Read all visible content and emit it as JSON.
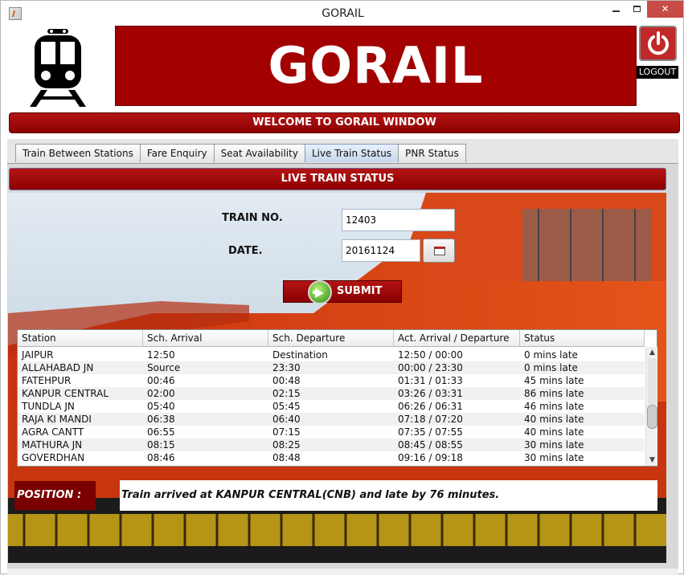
{
  "window": {
    "title": "GORAIL",
    "close_glyph": "✕",
    "icons": [
      "app-icon",
      "minimize-icon",
      "maximize-icon",
      "close-icon"
    ]
  },
  "header": {
    "banner_title": "GORAIL",
    "logout_label": "LOGOUT",
    "logo_icon": "train-icon",
    "logout_icon": "power-icon",
    "welcome": "WELCOME TO GORAIL WINDOW"
  },
  "tabs": [
    {
      "label": "Train Between Stations",
      "active": false
    },
    {
      "label": "Fare Enquiry",
      "active": false
    },
    {
      "label": "Seat Availability",
      "active": false
    },
    {
      "label": "Live Train Status",
      "active": true
    },
    {
      "label": "PNR Status",
      "active": false
    }
  ],
  "live_status": {
    "section_title": "LIVE TRAIN STATUS",
    "train_no_label": "TRAIN NO.",
    "train_no_value": "12403",
    "date_label": "DATE.",
    "date_value": "20161124",
    "calendar_icon": "calendar-icon",
    "submit_label": "SUBMIT",
    "submit_icon": "go-arrow-icon",
    "position_label": "POSITION :",
    "position_text": "Train arrived at KANPUR CENTRAL(CNB) and late by 76 minutes."
  },
  "table": {
    "headers": [
      "Station",
      "Sch. Arrival",
      "Sch. Departure",
      "Act. Arrival / Departure",
      "Status"
    ],
    "rows": [
      [
        "JAIPUR",
        "12:50",
        "Destination",
        "12:50 / 00:00",
        "0 mins late"
      ],
      [
        "ALLAHABAD JN",
        "Source",
        "23:30",
        "00:00 / 23:30",
        "0 mins late"
      ],
      [
        "FATEHPUR",
        "00:46",
        "00:48",
        "01:31 / 01:33",
        "45 mins late"
      ],
      [
        "KANPUR CENTRAL",
        "02:00",
        "02:15",
        "03:26 / 03:31",
        "86 mins late"
      ],
      [
        "TUNDLA JN",
        "05:40",
        "05:45",
        "06:26 / 06:31",
        "46 mins late"
      ],
      [
        "RAJA KI MANDI",
        "06:38",
        "06:40",
        "07:18 / 07:20",
        "40 mins late"
      ],
      [
        "AGRA CANTT",
        "06:55",
        "07:15",
        "07:35 / 07:55",
        "40 mins late"
      ],
      [
        "MATHURA JN",
        "08:15",
        "08:25",
        "08:45 / 08:55",
        "30 mins late"
      ],
      [
        "GOVERDHAN",
        "08:46",
        "08:48",
        "09:16 / 09:18",
        "30 mins late"
      ]
    ],
    "scroll_up": "▲",
    "scroll_down": "▼"
  },
  "colors": {
    "brand_red": "#a30000",
    "tab_active": "#c8d7ec",
    "position_bg": "#7a0000"
  }
}
